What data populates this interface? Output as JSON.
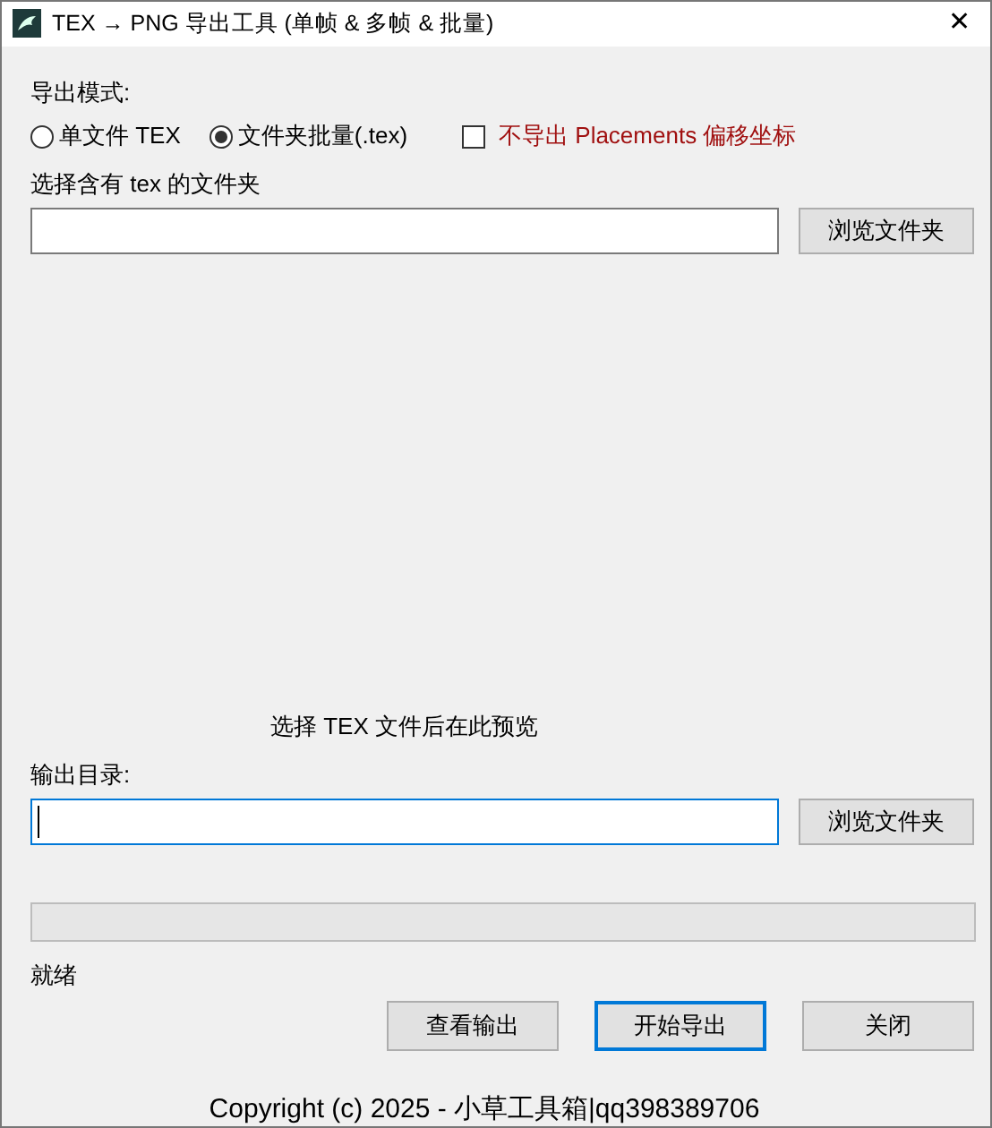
{
  "window": {
    "title": "TEX → PNG 导出工具 (单帧 & 多帧 & 批量)",
    "close": "✕"
  },
  "mode": {
    "label": "导出模式:",
    "options": [
      {
        "label": "单文件 TEX",
        "selected": false
      },
      {
        "label": "文件夹批量(.tex)",
        "selected": true
      }
    ],
    "checkbox": {
      "label": "不导出 Placements 偏移坐标",
      "checked": false
    }
  },
  "source": {
    "label": "选择含有 tex 的文件夹",
    "focused": false,
    "button": "浏览文件夹"
  },
  "preview": {
    "text": "选择 TEX 文件后在此预览"
  },
  "output": {
    "label": "输出目录:",
    "focused": true,
    "button": "浏览文件夹"
  },
  "progress": {
    "level": 0
  },
  "status": "就绪",
  "buttons": [
    {
      "label": "查看输出",
      "default": false
    },
    {
      "label": "开始导出",
      "default": true
    },
    {
      "label": "关闭",
      "default": false
    }
  ],
  "footer": "Copyright (c) 2025 - 小草工具箱|qq398389706"
}
